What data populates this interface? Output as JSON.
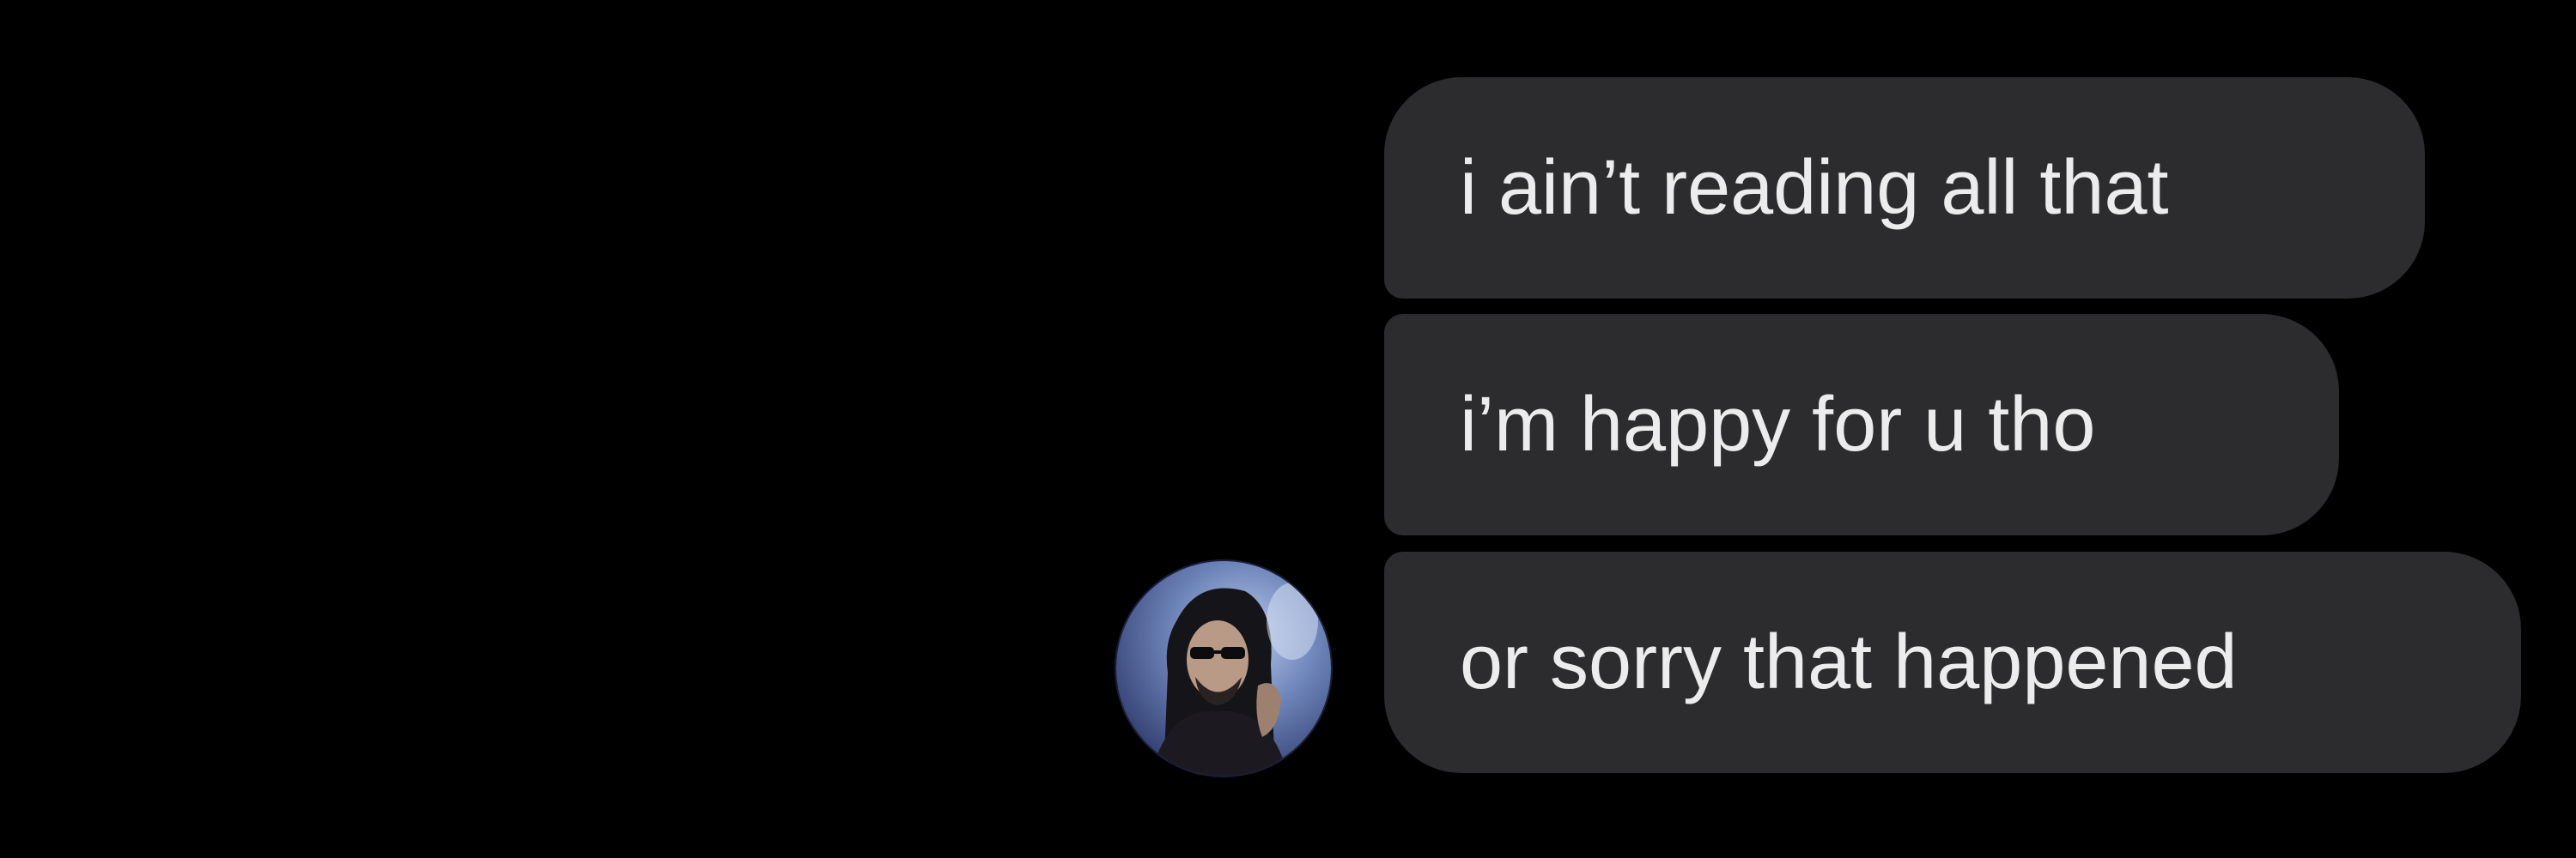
{
  "theme": {
    "background": "#000000",
    "bubble_color": "#2c2c2e",
    "text_color": "#ececec"
  },
  "conversation": {
    "messages": [
      {
        "text": "i ain’t reading all that"
      },
      {
        "text": "i’m happy for u tho"
      },
      {
        "text": "or sorry that happened"
      }
    ],
    "sender_avatar": {
      "icon": "user-avatar-photo"
    }
  }
}
